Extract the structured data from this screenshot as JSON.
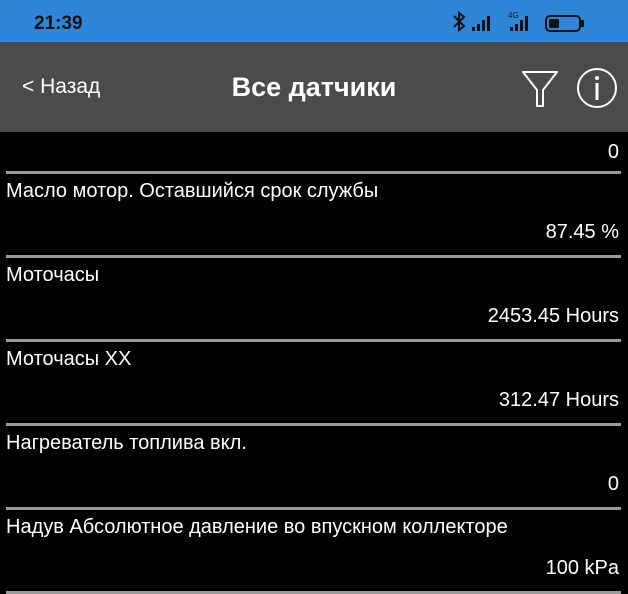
{
  "status": {
    "time": "21:39",
    "network_label": "4G"
  },
  "header": {
    "back_label": "< Назад",
    "title": "Все датчики",
    "filter_icon": "filter-icon",
    "info_icon": "info-icon"
  },
  "sensors": [
    {
      "name": "",
      "value": "0"
    },
    {
      "name": "Масло мотор. Оставшийся срок службы",
      "value": "87.45 %"
    },
    {
      "name": "Моточасы",
      "value": "2453.45 Hours"
    },
    {
      "name": "Моточасы ХХ",
      "value": "312.47 Hours"
    },
    {
      "name": "Нагреватель топлива вкл.",
      "value": "0"
    },
    {
      "name": "Надув Абсолютное давление во впускном коллекторе",
      "value": "100 kPa"
    }
  ],
  "colors": {
    "statusbar": "#2f86d8",
    "navbar": "#4b4b4b",
    "background": "#000000",
    "divider": "#9a9a9a",
    "text": "#ffffff"
  }
}
